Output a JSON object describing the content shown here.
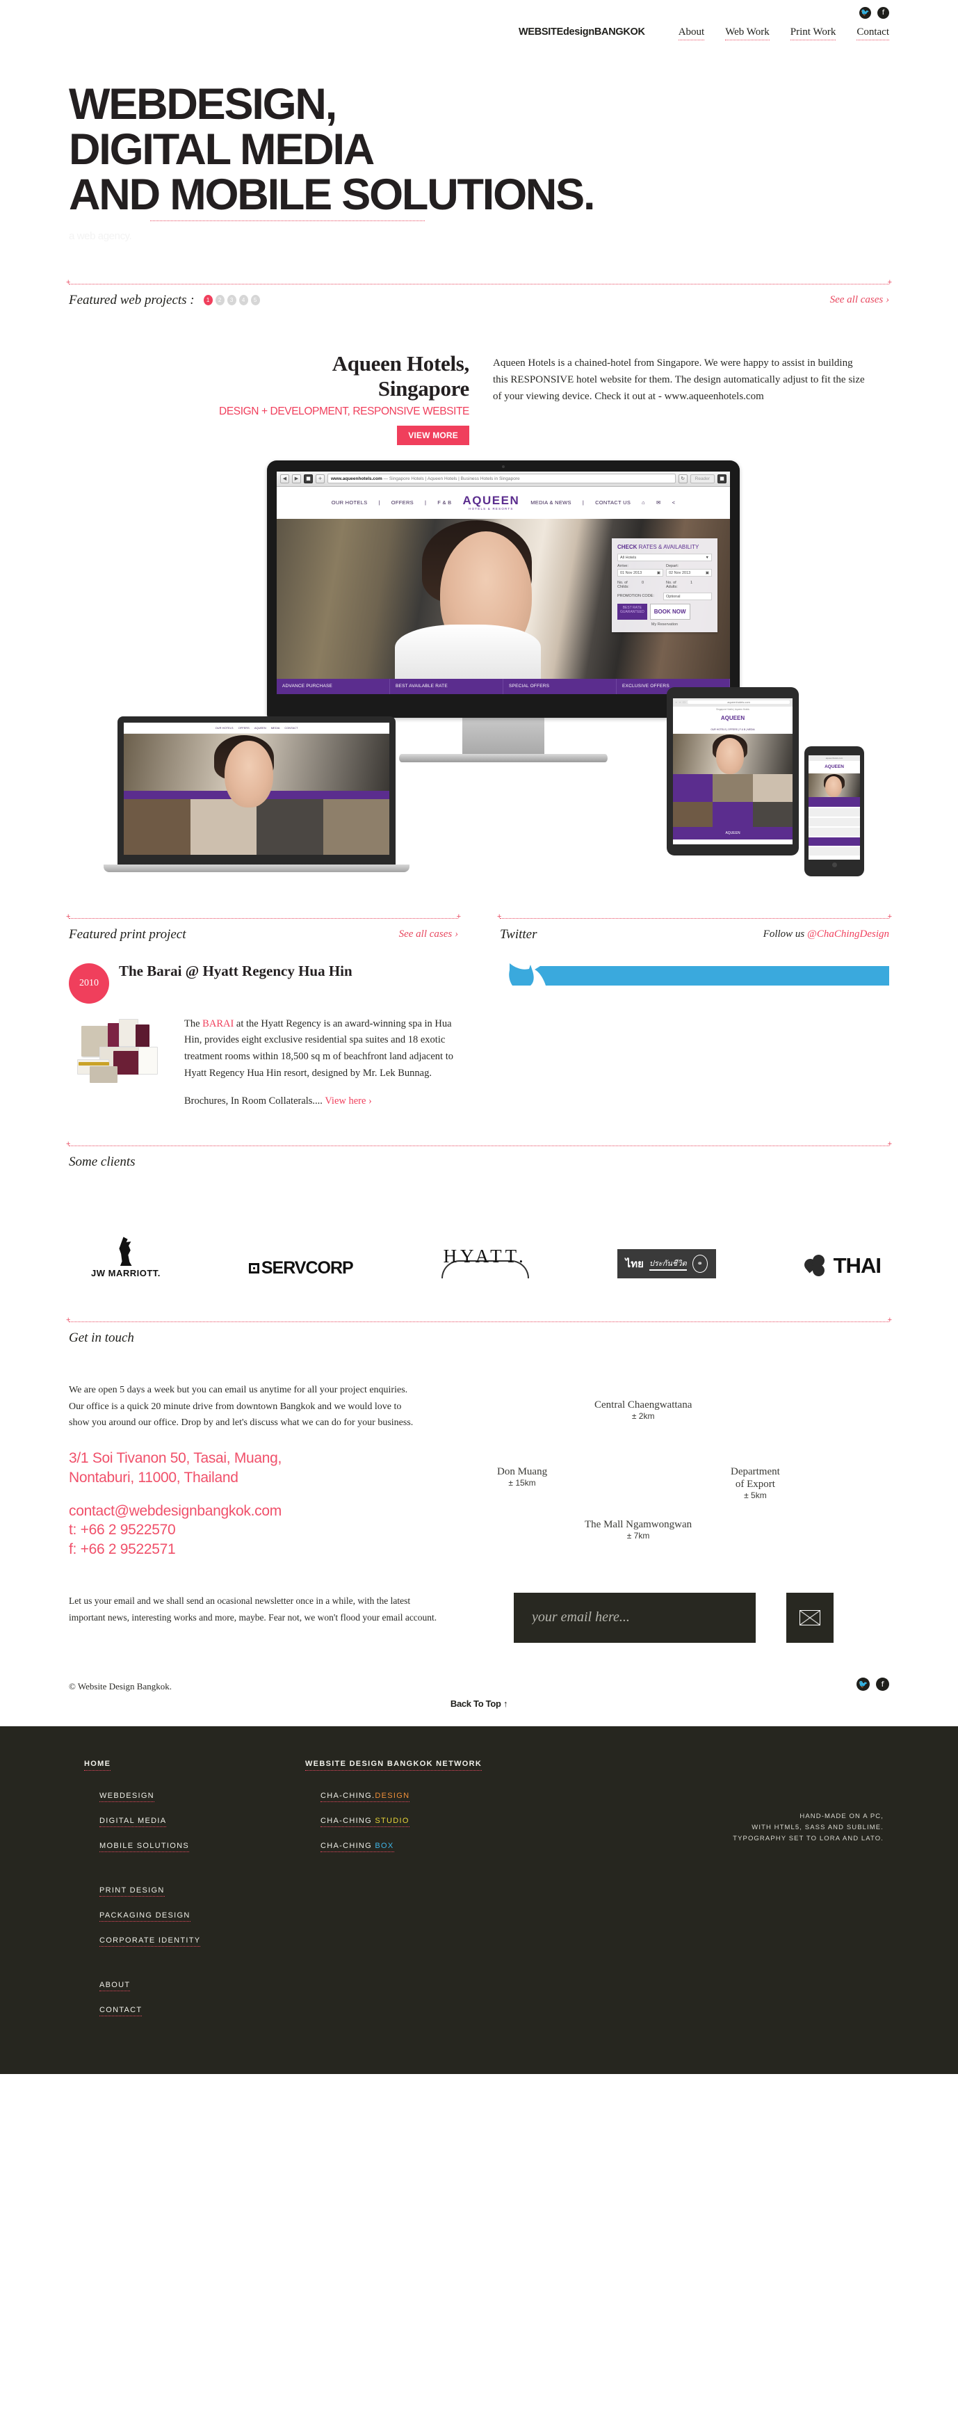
{
  "header": {
    "brand": "WEBSITEdesignBANGKOK",
    "nav": [
      {
        "label": "About"
      },
      {
        "label": "Web Work"
      },
      {
        "label": "Print Work"
      },
      {
        "label": "Contact"
      }
    ],
    "social": [
      {
        "name": "twitter-icon",
        "glyph": "✓"
      },
      {
        "name": "facebook-icon",
        "glyph": "f"
      }
    ]
  },
  "hero": {
    "line1": "WEBDESIGN,",
    "line2": "DIGITAL MEDIA",
    "line3": "AND MOBILE SOLUTIONS.",
    "tagline": "a web agency."
  },
  "featured_web": {
    "section_title": "Featured web projects :",
    "see_all": "See all cases ›",
    "pager": [
      "1",
      "2",
      "3",
      "4",
      "5"
    ],
    "active_page": "1",
    "project_title_line1": "Aqueen Hotels,",
    "project_title_line2": "Singapore",
    "project_subtitle": "DESIGN + DEVELOPMENT, RESPONSIVE WEBSITE",
    "button": "VIEW MORE",
    "description": "Aqueen Hotels is a chained-hotel from Singapore. We were happy to assist in building this RESPONSIVE hotel website for them. The design automatically adjust to fit the size of your viewing device. Check it out at - www.aqueenhotels.com",
    "mockup": {
      "browser_url": "www.aqueenhotels.com",
      "browser_title": "— Singapore Hotels | Aqueen Hotels | Business Hotels in Singapore",
      "reader_label": "Reader",
      "site_nav_left": [
        "OUR HOTELS",
        "OFFERS",
        "F & B"
      ],
      "site_nav_right": [
        "MEDIA & NEWS",
        "CONTACT US"
      ],
      "site_logo": "AQUEEN",
      "site_logo_sub": "HOTELS & RESORTS",
      "booking_title_strong": "CHECK",
      "booking_title_rest": " RATES & AVAILABILITY",
      "hotel_select": "All Hotels",
      "arrive_label": "Arrive:",
      "arrive_value": "01 Nov 2013",
      "depart_label": "Depart:",
      "depart_value": "02 Nov 2013",
      "childs_label": "No. of Childs:",
      "childs_value": "0",
      "adults_label": "No. of Adults:",
      "adults_value": "1",
      "promo_label": "PROMOTION CODE:",
      "promo_value": "Optional",
      "best_rate": "BEST RATE",
      "best_rate_sub": "GUARANTEED",
      "book_now": "BOOK NOW",
      "my_reservation": "My Reservation",
      "promo_bar": [
        "ADVANCE PURCHASE",
        "BEST AVAILABLE RATE",
        "SPECIAL OFFERS",
        "EXCLUSIVE OFFERS"
      ]
    }
  },
  "featured_print": {
    "section_title": "Featured print project",
    "see_all": "See all cases ›",
    "year": "2010",
    "title": "The Barai @ Hyatt Regency Hua Hin",
    "body_pre": "The ",
    "body_highlight": "BARAI",
    "body_post": " at the Hyatt Regency is an award-winning spa in Hua Hin, provides eight exclusive residential spa suites and 18 exotic treatment rooms within 18,500 sq m of beachfront land adjacent to Hyatt Regency Hua Hin resort, designed by Mr. Lek Bunnag.",
    "footer_text": "Brochures, In Room Collaterals....",
    "footer_link": "View here ›"
  },
  "twitter": {
    "section_title": "Twitter",
    "follow_prefix": "Follow us ",
    "handle": "@ChaChingDesign"
  },
  "clients": {
    "section_title": "Some clients",
    "logos": [
      {
        "name": "jw-marriott-logo",
        "text": "JW MARRIOTT."
      },
      {
        "name": "servcorp-logo",
        "text": "SERVCORP"
      },
      {
        "name": "hyatt-logo",
        "text": "HYATT."
      },
      {
        "name": "thai-life-insurance-logo",
        "text_thai": "ไทย",
        "text_thai2": "ประกันชีวิต"
      },
      {
        "name": "thai-airways-logo",
        "text": "THAI"
      }
    ]
  },
  "get_in_touch": {
    "section_title": "Get in touch",
    "paragraph": "We are open 5 days a week but you can email us anytime for all your project enquiries. Our office is a quick 20 minute drive from downtown Bangkok and we would love to show you around our office. Drop by and let's discuss what we can do for your business.",
    "address_line1": "3/1 Soi Tivanon 50, Tasai, Muang,",
    "address_line2": "Nontaburi, 11000, Thailand",
    "email": "contact@webdesignbangkok.com",
    "tel": "t: +66 2 9522570",
    "fax": "f: +66 2 9522571",
    "map_points": [
      {
        "name": "Central Chaengwattana",
        "distance": "± 2km"
      },
      {
        "name": "Don Muang",
        "distance": "± 15km"
      },
      {
        "name_line1": "Department",
        "name_line2": "of Export",
        "distance": "± 5km"
      },
      {
        "name": "The Mall Ngamwongwan",
        "distance": "± 7km"
      }
    ]
  },
  "newsletter": {
    "text": "Let us your email and we shall send an ocasional newsletter once in a while, with the latest important news, interesting works and more, maybe. Fear not, we won't flood your email account.",
    "placeholder": "your email here...",
    "value": "",
    "submit_icon": "envelope-icon"
  },
  "bottom_bar": {
    "copyright": "© Website Design Bangkok.",
    "back_to_top": "Back To Top ↑",
    "social": [
      {
        "name": "twitter-icon",
        "glyph": "✓"
      },
      {
        "name": "facebook-icon",
        "glyph": "f"
      }
    ]
  },
  "footer": {
    "home_head": "HOME",
    "network_head": "WEBSITE DESIGN BANGKOK NETWORK",
    "group1": [
      "WEBDESIGN",
      "DIGITAL MEDIA",
      "MOBILE SOLUTIONS"
    ],
    "group2": [
      "PRINT DESIGN",
      "PACKAGING DESIGN",
      "CORPORATE IDENTITY"
    ],
    "group3": [
      "ABOUT",
      "CONTACT"
    ],
    "network": [
      {
        "base": "CHA-CHING.",
        "accent": "DESIGN",
        "accent_class": "c-orange"
      },
      {
        "base": "CHA-CHING ",
        "accent": "STUDIO",
        "accent_class": "c-yellow"
      },
      {
        "base": "CHA-CHING ",
        "accent": "BOX",
        "accent_class": "c-blue"
      }
    ],
    "note_line1": "HAND-MADE ON A PC,",
    "note_line2": "WITH HTML5, SASS AND SUBLIME.",
    "note_line3": "TYPOGRAPHY SET TO LORA AND LATO."
  },
  "colors": {
    "accent_red": "#f03f5c",
    "dark": "#26261f",
    "twitter_blue": "#3aa9dd",
    "purple": "#5b2d8e"
  }
}
